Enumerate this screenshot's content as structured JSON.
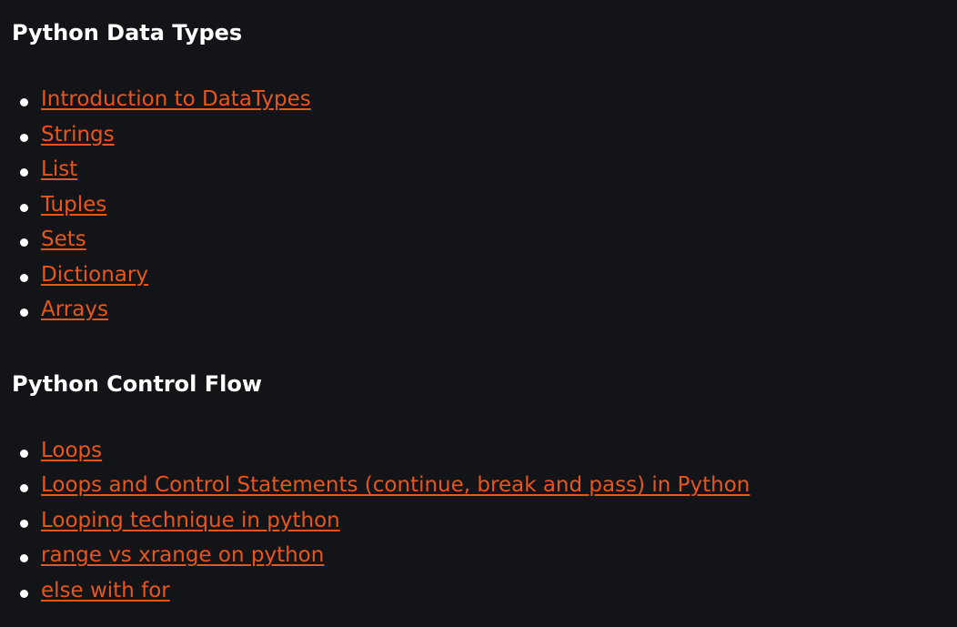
{
  "sections": [
    {
      "title": "Python Data Types",
      "links": [
        {
          "label": "Introduction to DataTypes"
        },
        {
          "label": "Strings"
        },
        {
          "label": "List"
        },
        {
          "label": "Tuples"
        },
        {
          "label": "Sets"
        },
        {
          "label": "Dictionary"
        },
        {
          "label": "Arrays"
        }
      ]
    },
    {
      "title": "Python Control Flow",
      "links": [
        {
          "label": "Loops"
        },
        {
          "label": "Loops and Control Statements (continue, break and pass) in Python"
        },
        {
          "label": "Looping technique in python"
        },
        {
          "label": "range vs xrange on python"
        },
        {
          "label": "else with for"
        }
      ]
    }
  ],
  "colors": {
    "background": "#131417",
    "link": "#e8561c",
    "text": "#ffffff"
  }
}
